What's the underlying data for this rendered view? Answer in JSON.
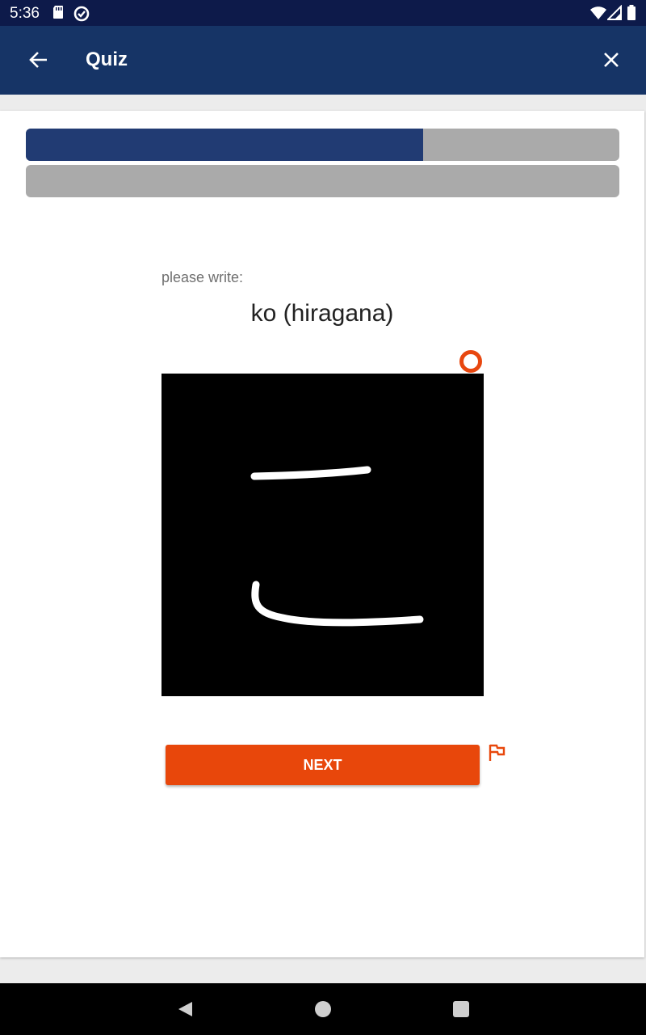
{
  "status_bar": {
    "time": "5:36",
    "icons": [
      "sd-card-icon",
      "data-saver-icon",
      "wifi-icon",
      "cell-signal-icon",
      "battery-icon"
    ]
  },
  "app_bar": {
    "title": "Quiz",
    "back_icon": "arrow-back-icon",
    "close_icon": "close-icon",
    "color": "#163466"
  },
  "progress": {
    "primary_fraction": 0.67,
    "secondary_fraction": 0.0,
    "fill_color": "#213b73",
    "track_color": "#aaaaaa"
  },
  "question": {
    "label": "please write:",
    "prompt": "ko (hiragana)"
  },
  "canvas": {
    "background": "#000000",
    "stroke_color": "#ffffff",
    "stroke_count": 2,
    "indicator_icon": "stroke-indicator-icon"
  },
  "actions": {
    "next_label": "NEXT",
    "accent_color": "#e8470b",
    "flag_icon": "flag-icon"
  },
  "nav_bar": {
    "icons": [
      "nav-back-icon",
      "nav-home-icon",
      "nav-recents-icon"
    ]
  }
}
